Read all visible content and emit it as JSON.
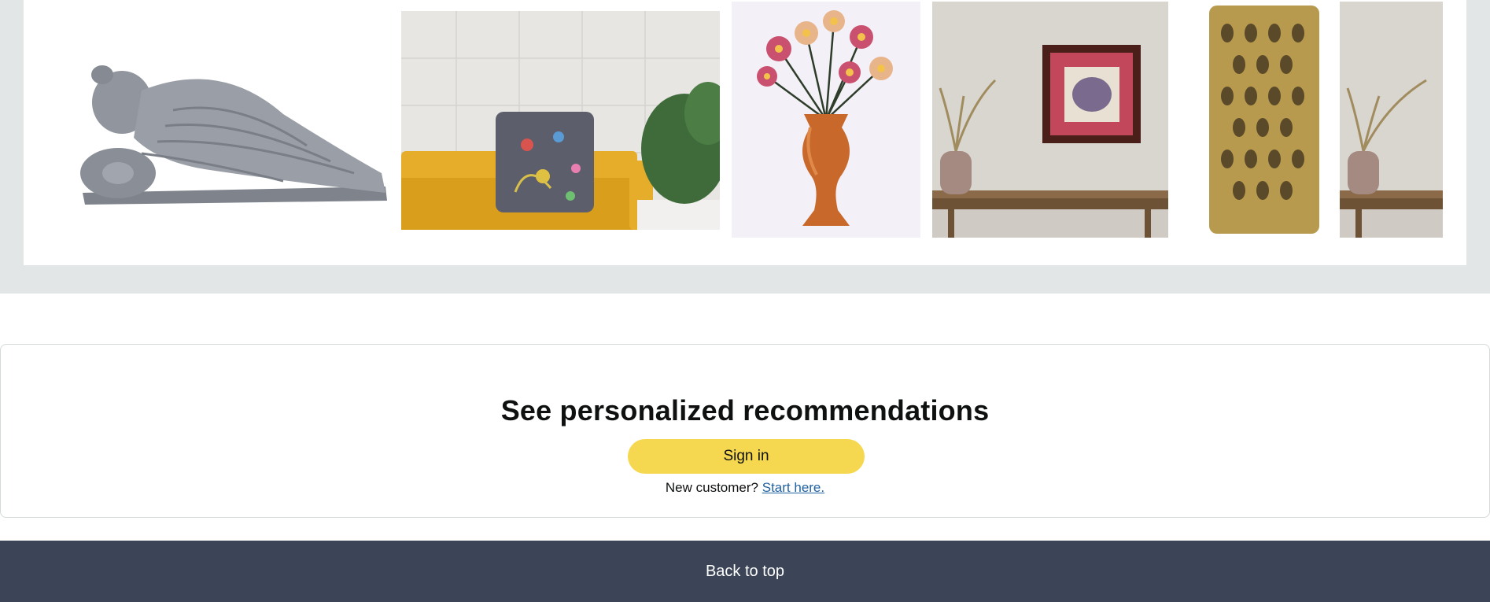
{
  "carousel": {
    "products": [
      {
        "icon": "reclining-buddha-statue-image"
      },
      {
        "icon": "embroidered-cushion-on-sofa-image"
      },
      {
        "icon": "flower-vase-image"
      },
      {
        "icon": "framed-wall-art-image"
      },
      {
        "icon": "soapstone-lantern-image"
      },
      {
        "icon": "pampas-vase-image"
      }
    ]
  },
  "recommendations": {
    "title": "See personalized recommendations",
    "sign_in_label": "Sign in",
    "new_customer_text": "New customer?",
    "start_here_label": "Start here."
  },
  "footer": {
    "back_to_top_label": "Back to top"
  },
  "colors": {
    "band": "#e3e6e6",
    "sign_in_button": "#f5d84f",
    "link": "#2162a1",
    "footer": "#3b4557"
  }
}
